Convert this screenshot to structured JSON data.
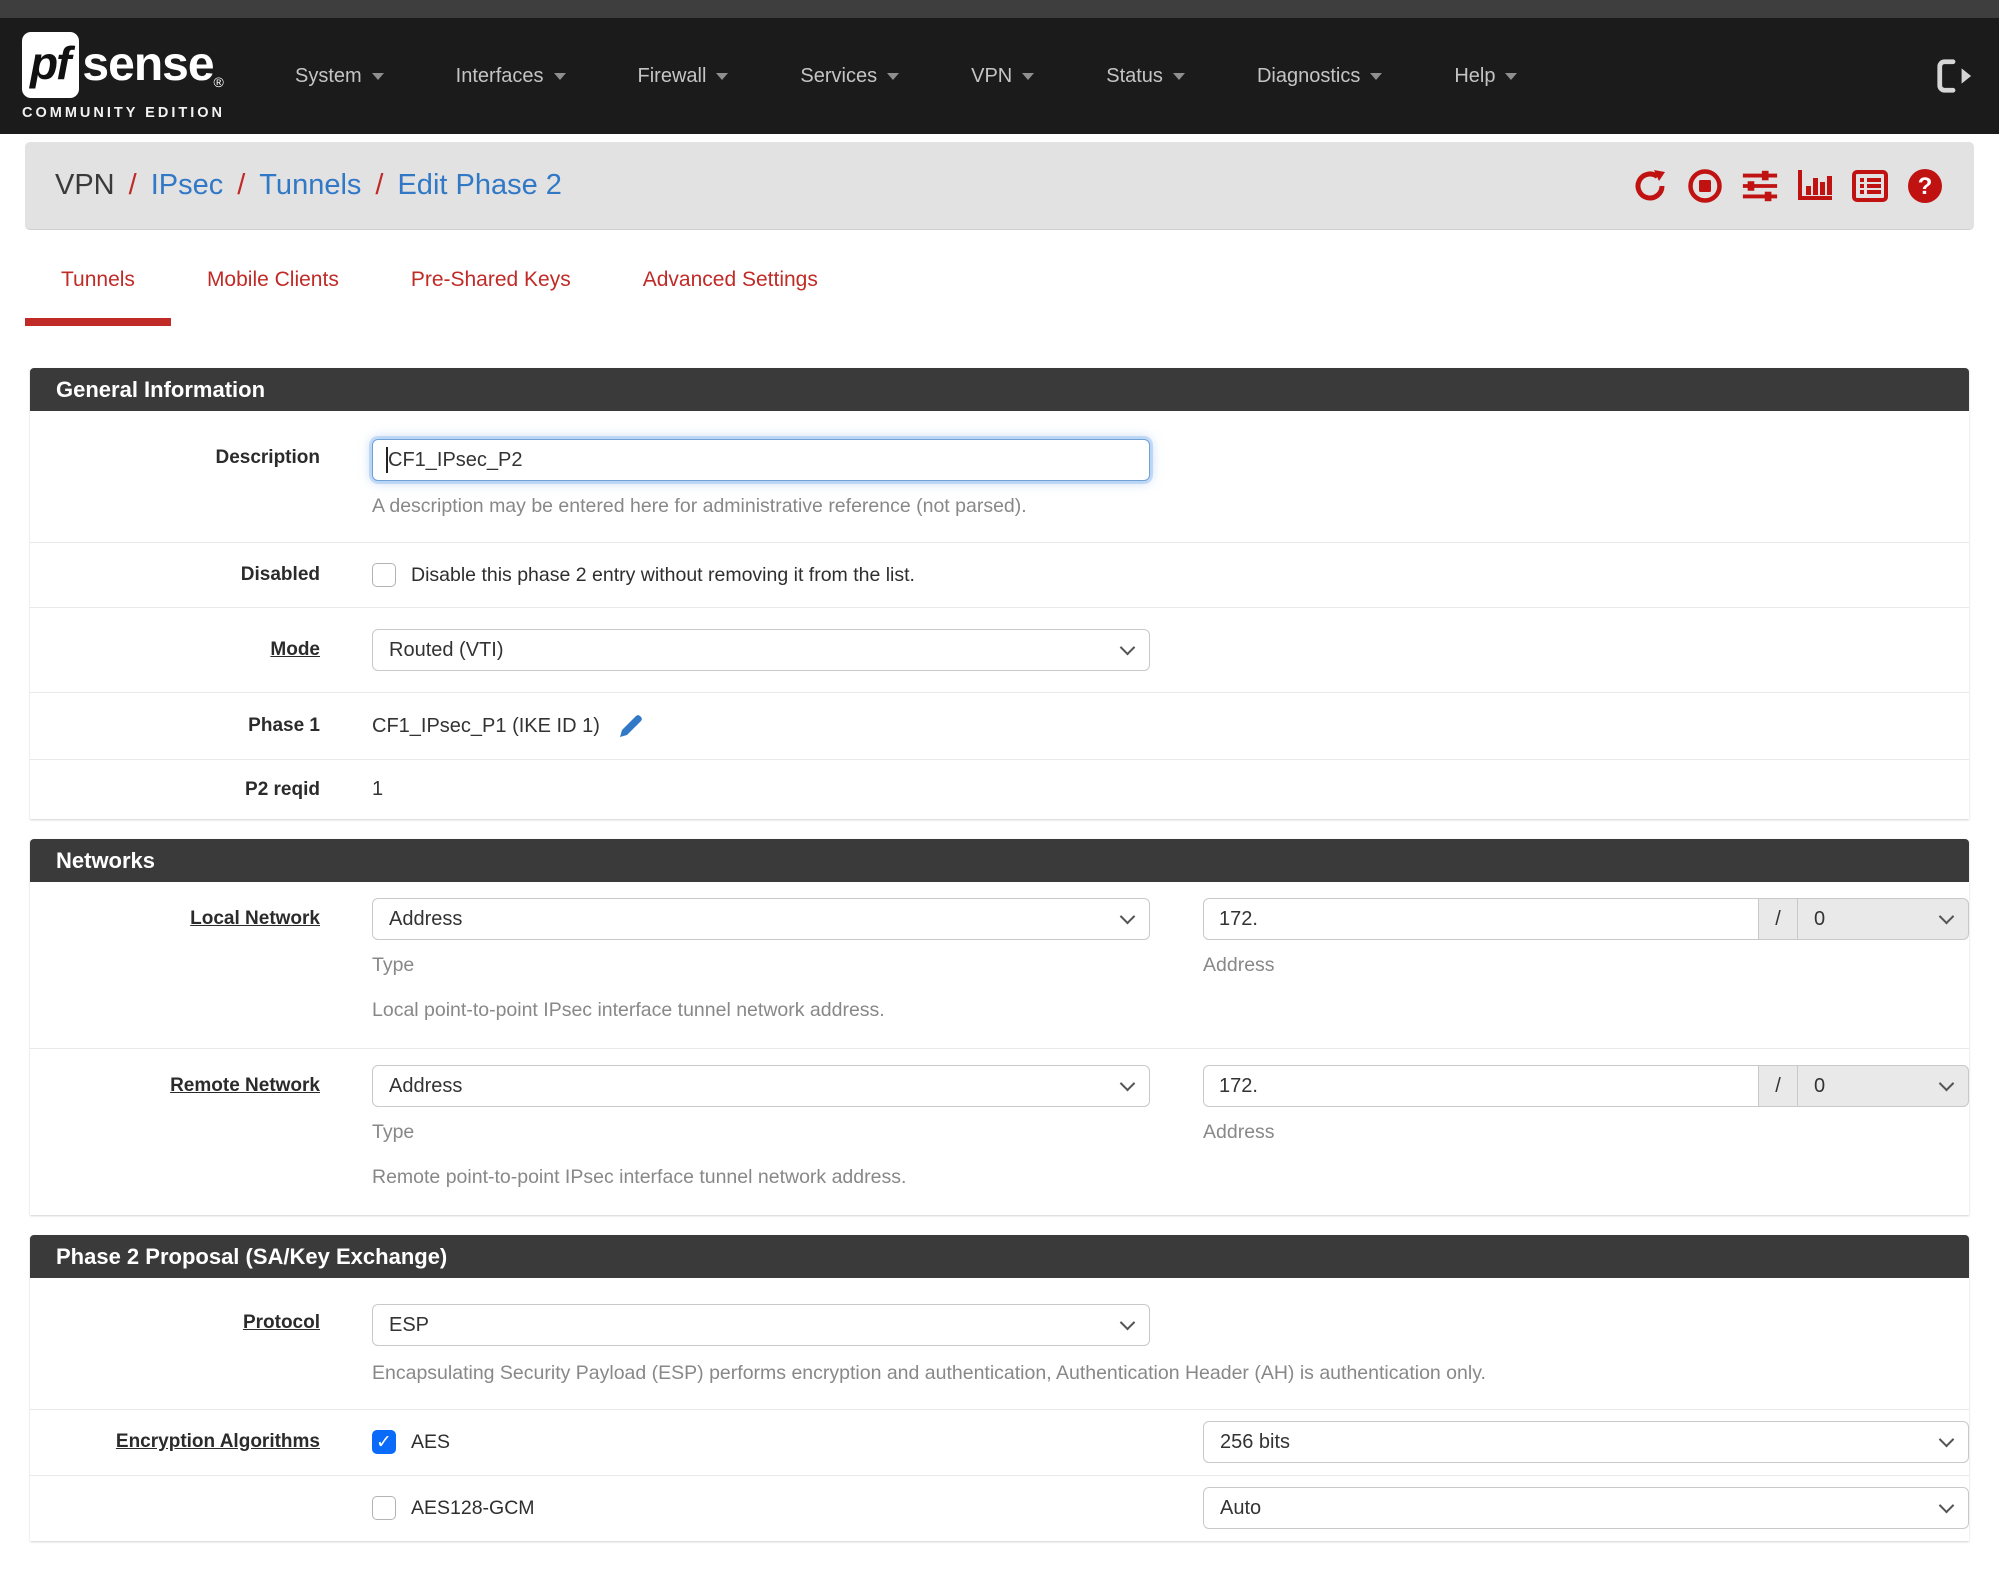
{
  "colors": {
    "accent_red": "#c02b27",
    "icon_red": "#c11212",
    "link_blue": "#3178c6",
    "navbar_bg": "#1b1b1b",
    "section_header_bg": "#3a3a3a",
    "checkbox_blue": "#0a6bfb",
    "breadcrumb_bg": "#e2e2e2"
  },
  "navbar": {
    "brand": {
      "pf": "pf",
      "sense": "sense",
      "reg": "®",
      "edition": "COMMUNITY EDITION"
    },
    "items": [
      {
        "label": "System"
      },
      {
        "label": "Interfaces"
      },
      {
        "label": "Firewall"
      },
      {
        "label": "Services"
      },
      {
        "label": "VPN"
      },
      {
        "label": "Status"
      },
      {
        "label": "Diagnostics"
      },
      {
        "label": "Help"
      }
    ]
  },
  "breadcrumb": {
    "root": "VPN",
    "sep": "/",
    "links": [
      "IPsec",
      "Tunnels",
      "Edit Phase 2"
    ],
    "toolbar_icons": [
      "refresh-icon",
      "stop-circle-icon",
      "sliders-icon",
      "bar-chart-icon",
      "list-icon",
      "help-icon"
    ]
  },
  "tabs": [
    {
      "label": "Tunnels",
      "active": true
    },
    {
      "label": "Mobile Clients",
      "active": false
    },
    {
      "label": "Pre-Shared Keys",
      "active": false
    },
    {
      "label": "Advanced Settings",
      "active": false
    }
  ],
  "general": {
    "title": "General Information",
    "description": {
      "label": "Description",
      "value": "CF1_IPsec_P2",
      "help": "A description may be entered here for administrative reference (not parsed)."
    },
    "disabled": {
      "label": "Disabled",
      "checked": false,
      "checkbox_label": "Disable this phase 2 entry without removing it from the list."
    },
    "mode": {
      "label": "Mode",
      "value": "Routed (VTI)"
    },
    "phase1": {
      "label": "Phase 1",
      "value": "CF1_IPsec_P1 (IKE ID 1)"
    },
    "p2reqid": {
      "label": "P2 reqid",
      "value": "1"
    }
  },
  "networks": {
    "title": "Networks",
    "local": {
      "label": "Local Network",
      "type_value": "Address",
      "type_caption": "Type",
      "address_value": "172.",
      "slash": "/",
      "prefix_value": "0",
      "address_caption": "Address",
      "help": "Local point-to-point IPsec interface tunnel network address."
    },
    "remote": {
      "label": "Remote Network",
      "type_value": "Address",
      "type_caption": "Type",
      "address_value": "172.",
      "slash": "/",
      "prefix_value": "0",
      "address_caption": "Address",
      "help": "Remote point-to-point IPsec interface tunnel network address."
    }
  },
  "proposal": {
    "title": "Phase 2 Proposal (SA/Key Exchange)",
    "protocol": {
      "label": "Protocol",
      "value": "ESP",
      "help": "Encapsulating Security Payload (ESP) performs encryption and authentication, Authentication Header (AH) is authentication only."
    },
    "encryption": {
      "label": "Encryption Algorithms",
      "rows": [
        {
          "name": "AES",
          "checked": true,
          "bits": "256 bits"
        },
        {
          "name": "AES128-GCM",
          "checked": false,
          "bits": "Auto"
        }
      ]
    }
  }
}
